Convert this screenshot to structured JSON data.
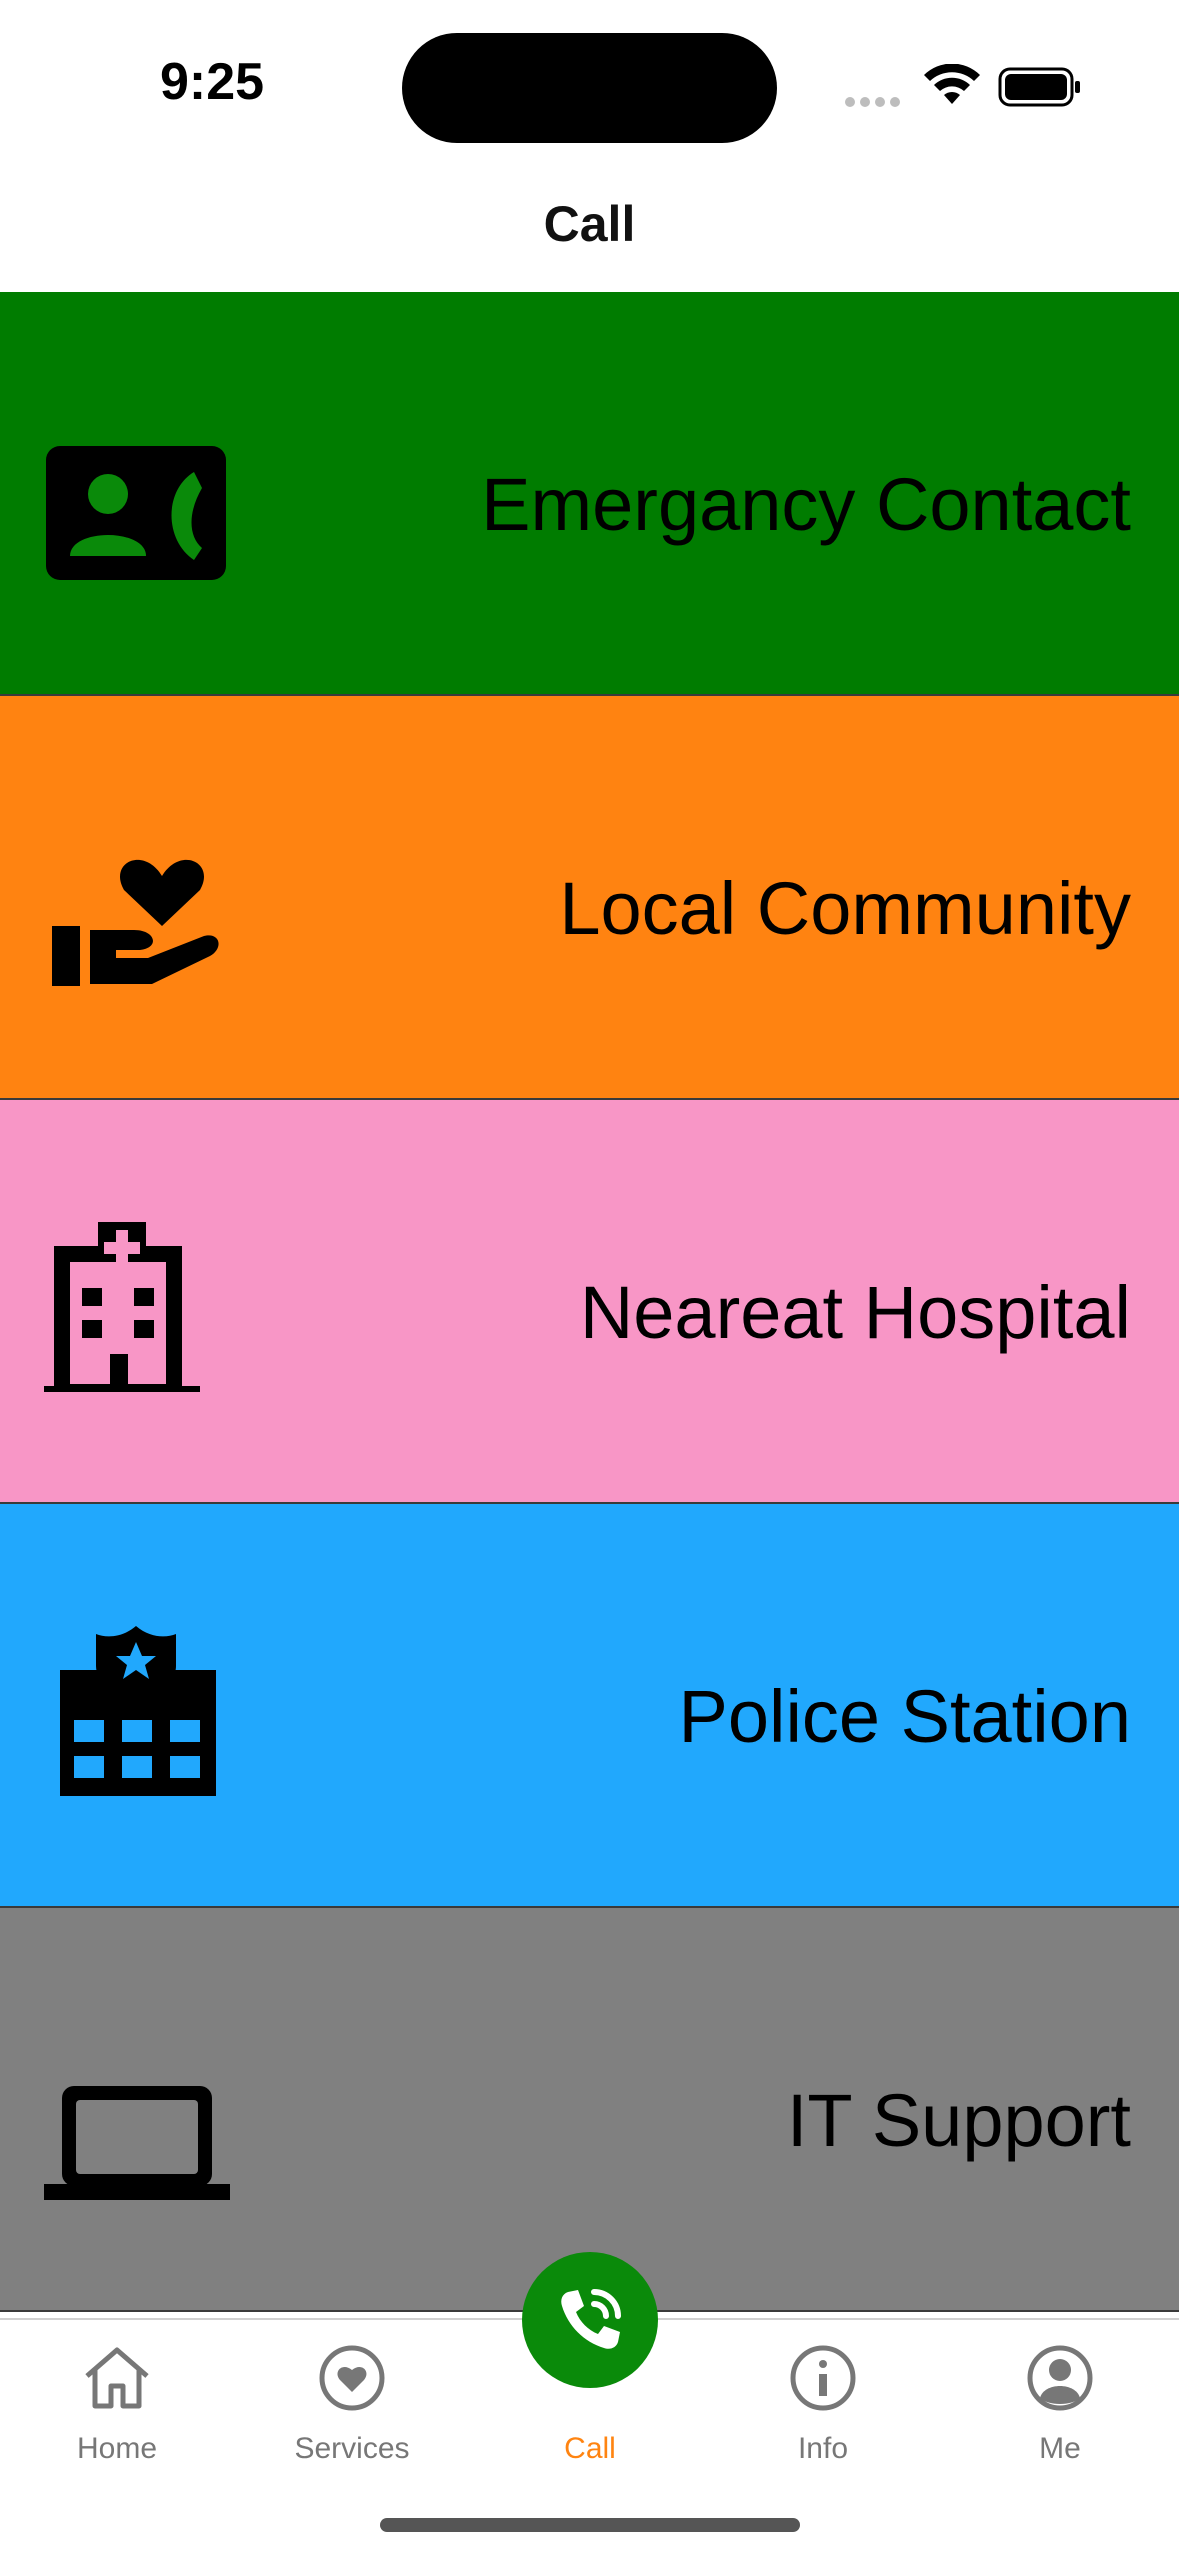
{
  "status_bar": {
    "time": "9:25"
  },
  "nav": {
    "title": "Call"
  },
  "items": [
    {
      "label": "Emergancy Contact",
      "icon": "contact-phone-icon",
      "color": "#007c00"
    },
    {
      "label": "Local Community",
      "icon": "volunteer-heart-hand-icon",
      "color": "#ff8311"
    },
    {
      "label": "Neareat Hospital",
      "icon": "hospital-building-icon",
      "color": "#f896c6"
    },
    {
      "label": "Police Station",
      "icon": "police-station-icon",
      "color": "#21a8fd"
    },
    {
      "label": "IT Support",
      "icon": "laptop-icon",
      "color": "#808080"
    }
  ],
  "tabs": [
    {
      "label": "Home",
      "icon": "home-icon"
    },
    {
      "label": "Services",
      "icon": "heart-circle-icon"
    },
    {
      "label": "Call",
      "icon": "phone-call-icon",
      "active": true
    },
    {
      "label": "Info",
      "icon": "info-circle-icon"
    },
    {
      "label": "Me",
      "icon": "person-circle-icon"
    }
  ],
  "colors": {
    "accent": "#ff8411",
    "call_button": "#0a8a0a"
  }
}
